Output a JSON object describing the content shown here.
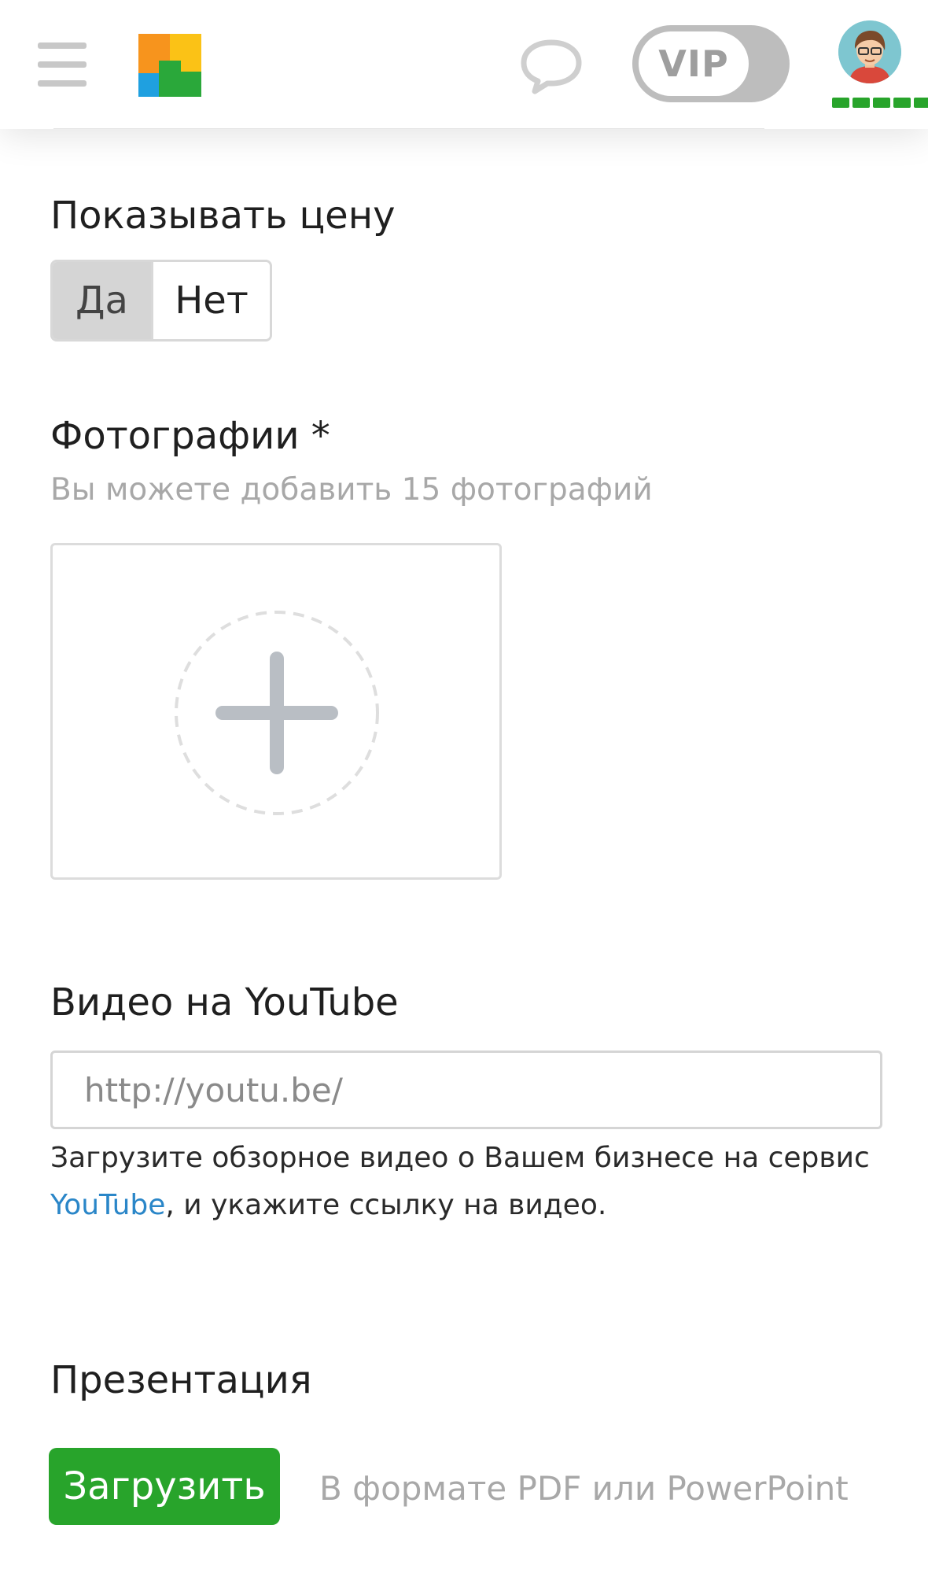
{
  "header": {
    "vip_label": "VIP",
    "level_segments": 5,
    "colors": {
      "logo": [
        "#f7941d",
        "#fbc216",
        "#1fa0e0",
        "#2aa83a"
      ],
      "accent": "#28a42b"
    }
  },
  "show_price": {
    "label": "Показывать цену",
    "options": [
      "Да",
      "Нет"
    ],
    "selected": "Да"
  },
  "photos": {
    "label": "Фотографии *",
    "hint": "Вы можете добавить 15 фотографий"
  },
  "youtube": {
    "label": "Видео на YouTube",
    "placeholder": "http://youtu.be/",
    "description_before": "Загрузите обзорное видео о Вашем бизнесе на сервис ",
    "link_text": "YouTube",
    "description_after": ", и укажите ссылку на видео."
  },
  "presentation": {
    "label": "Презентация",
    "upload_label": "Загрузить",
    "hint": "В формате PDF или PowerPoint"
  }
}
